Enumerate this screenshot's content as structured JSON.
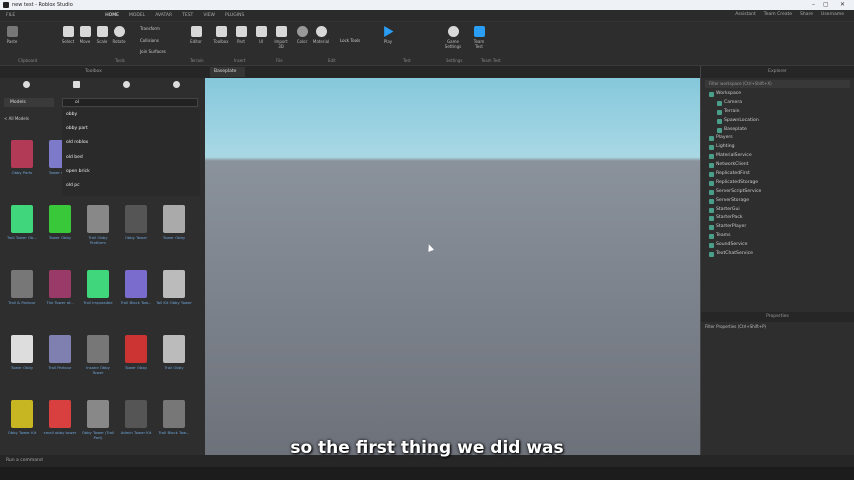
{
  "window": {
    "title": "new test - Roblox Studio"
  },
  "menu": {
    "file": "FILE",
    "tabs": [
      "HOME",
      "MODEL",
      "AVATAR",
      "TEST",
      "VIEW",
      "PLUGINS"
    ],
    "selected": 0,
    "right": [
      "Assistant",
      "Team Create",
      "Share",
      "Username"
    ]
  },
  "ribbon": {
    "tools": [
      {
        "label": "Paste"
      },
      {
        "label": "Select"
      },
      {
        "label": "Move"
      },
      {
        "label": "Scale"
      },
      {
        "label": "Rotate"
      },
      {
        "label": "Editor"
      },
      {
        "label": "Toolbox"
      },
      {
        "label": "Part"
      },
      {
        "label": "UI"
      },
      {
        "label": "Import 3D"
      },
      {
        "label": "Color"
      },
      {
        "label": "Material"
      },
      {
        "label": "Play"
      },
      {
        "label": "Game Settings"
      },
      {
        "label": "Team Test"
      }
    ],
    "transform": "Transform",
    "collisions": "Collisions",
    "join_surfaces": "Join Surfaces",
    "lock": "Lock Tools",
    "groups": [
      "Clipboard",
      "Tools",
      "Terrain",
      "Insert",
      "File",
      "Edit",
      "Test",
      "Settings",
      "Team Test"
    ]
  },
  "toolbox": {
    "title": "Toolbox",
    "category": "Models",
    "search": "ol",
    "all_models": "< All Models",
    "suggestions": [
      "obby",
      "obby part",
      "old roblox",
      "old bed",
      "open brick",
      "old pc"
    ],
    "items": [
      {
        "label": "Obby Parts",
        "color": "#b23a56"
      },
      {
        "label": "Tower Obby",
        "color": "#7d7ac9"
      },
      {
        "label": "",
        "color": "#2e2e2e"
      },
      {
        "label": "",
        "color": "#2e2e2e"
      },
      {
        "label": "",
        "color": "#2e2e2e"
      },
      {
        "label": "Troll Tower Ob...",
        "color": "#3fd67c"
      },
      {
        "label": "Tower Obby",
        "color": "#38c83a"
      },
      {
        "label": "Troll Obby Platform",
        "color": "#888"
      },
      {
        "label": "Obby Tower",
        "color": "#555"
      },
      {
        "label": "Tower Obby",
        "color": "#aaa"
      },
      {
        "label": "Troll & Parkour",
        "color": "#777"
      },
      {
        "label": "The Tower of...",
        "color": "#9a3a68"
      },
      {
        "label": "Troll Impossible",
        "color": "#3fd67c"
      },
      {
        "label": "Troll Block Tow...",
        "color": "#7a6ccc"
      },
      {
        "label": "Tall Kit Obby Tower",
        "color": "#bbb"
      },
      {
        "label": "Tower Obby",
        "color": "#ddd"
      },
      {
        "label": "Troll Parkour",
        "color": "#8080b0"
      },
      {
        "label": "Insane Obby Tower",
        "color": "#777"
      },
      {
        "label": "Tower Obby",
        "color": "#c33"
      },
      {
        "label": "Troll Obby",
        "color": "#bbb"
      },
      {
        "label": "Obby Tower Kit",
        "color": "#c8b522"
      },
      {
        "label": "small obby tower",
        "color": "#d84040"
      },
      {
        "label": "Obby Tower (Troll Part)",
        "color": "#888"
      },
      {
        "label": "Admin Tower Kit",
        "color": "#555"
      },
      {
        "label": "Troll Block Tow...",
        "color": "#777"
      }
    ]
  },
  "viewport": {
    "tab": "Baseplate"
  },
  "explorer": {
    "title": "Explorer",
    "filter": "Filter workspace (Ctrl+Shift+X)",
    "items": [
      {
        "label": "Workspace",
        "indent": 0
      },
      {
        "label": "Camera",
        "indent": 1
      },
      {
        "label": "Terrain",
        "indent": 1
      },
      {
        "label": "SpawnLocation",
        "indent": 1
      },
      {
        "label": "Baseplate",
        "indent": 1
      },
      {
        "label": "Players",
        "indent": 0
      },
      {
        "label": "Lighting",
        "indent": 0
      },
      {
        "label": "MaterialService",
        "indent": 0
      },
      {
        "label": "NetworkClient",
        "indent": 0
      },
      {
        "label": "ReplicatedFirst",
        "indent": 0
      },
      {
        "label": "ReplicatedStorage",
        "indent": 0
      },
      {
        "label": "ServerScriptService",
        "indent": 0
      },
      {
        "label": "ServerStorage",
        "indent": 0
      },
      {
        "label": "StarterGui",
        "indent": 0
      },
      {
        "label": "StarterPack",
        "indent": 0
      },
      {
        "label": "StarterPlayer",
        "indent": 0
      },
      {
        "label": "Teams",
        "indent": 0
      },
      {
        "label": "SoundService",
        "indent": 0
      },
      {
        "label": "TextChatService",
        "indent": 0
      }
    ]
  },
  "properties": {
    "title": "Properties",
    "filter": "Filter Properties (Ctrl+Shift+P)"
  },
  "status": {
    "text": "Run a command"
  },
  "subtitle": "so the first thing we did was"
}
